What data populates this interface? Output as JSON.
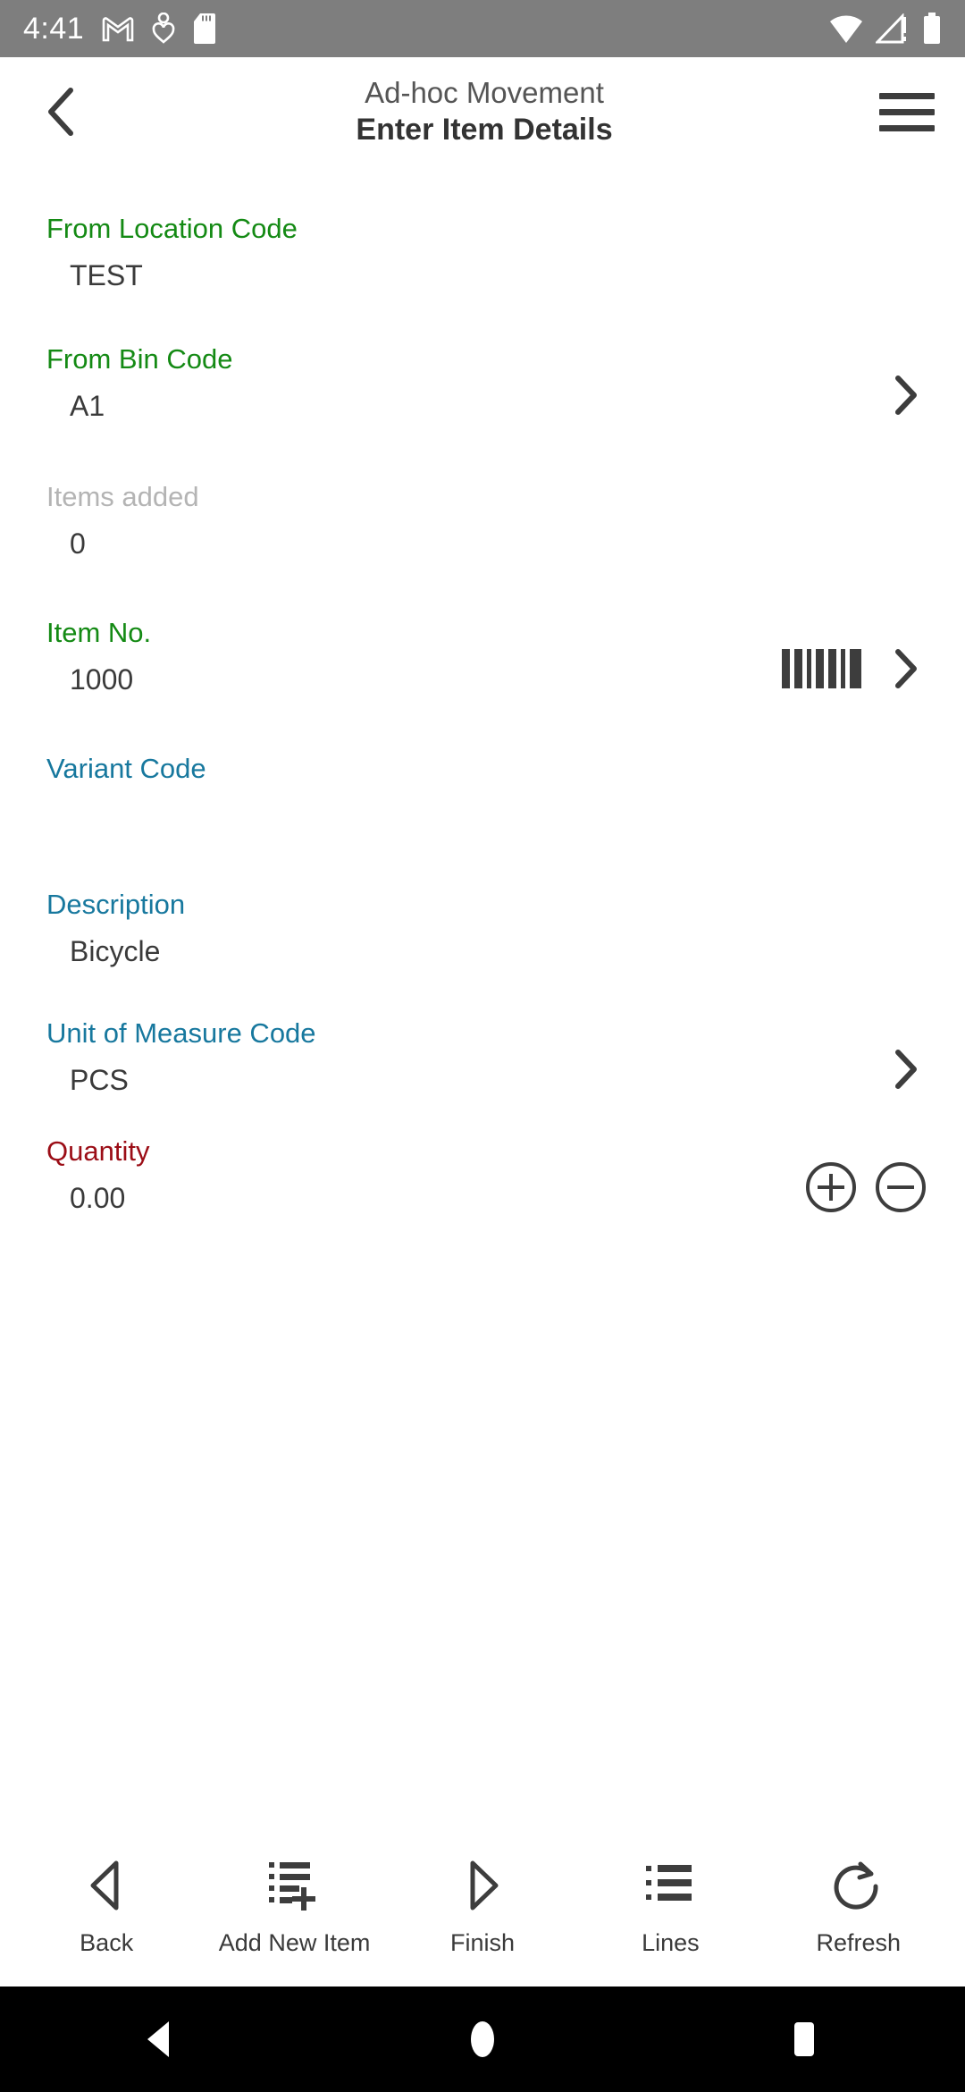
{
  "statusbar": {
    "time": "4:41",
    "left_icons": [
      "gmail-icon",
      "fitness-heart-icon",
      "sd-card-icon"
    ],
    "right_icons": [
      "wifi-icon",
      "cellular-no-signal-icon",
      "battery-icon"
    ]
  },
  "header": {
    "back": "back-chevron-icon",
    "subtitle": "Ad-hoc Movement",
    "title": "Enter Item Details",
    "menu": "hamburger-menu-icon"
  },
  "form": {
    "fields": [
      {
        "name": "from-location-code",
        "label": "From Location Code",
        "value": "TEST",
        "label_color": "#148a14",
        "style": "green",
        "actions": []
      },
      {
        "name": "from-bin-code",
        "label": "From Bin Code",
        "value": "A1",
        "label_color": "#148a14",
        "style": "green",
        "actions": [
          "chevron-right-icon"
        ]
      },
      {
        "name": "items-added",
        "label": "Items added",
        "value": "0",
        "label_color": "#b4b4b4",
        "style": "gray",
        "actions": []
      },
      {
        "name": "item-no",
        "label": "Item No.",
        "value": "1000",
        "label_color": "#148a14",
        "style": "green",
        "actions": [
          "barcode-scan-icon",
          "chevron-right-icon"
        ]
      },
      {
        "name": "variant-code",
        "label": "Variant Code",
        "value": "",
        "label_color": "#17789e",
        "style": "teal",
        "actions": []
      },
      {
        "name": "description",
        "label": "Description",
        "value": "Bicycle",
        "label_color": "#17789e",
        "style": "teal",
        "actions": []
      },
      {
        "name": "unit-of-measure-code",
        "label": "Unit of Measure Code",
        "value": "PCS",
        "label_color": "#17789e",
        "style": "teal",
        "actions": [
          "chevron-right-icon"
        ]
      },
      {
        "name": "quantity",
        "label": "Quantity",
        "value": "0.00",
        "label_color": "#9b0d16",
        "style": "red",
        "actions": [
          "plus-circle-icon",
          "minus-circle-icon"
        ]
      }
    ]
  },
  "toolbar": {
    "items": [
      {
        "name": "back",
        "label": "Back",
        "icon": "triangle-left-icon"
      },
      {
        "name": "add-new-item",
        "label": "Add New Item",
        "icon": "list-add-icon"
      },
      {
        "name": "finish",
        "label": "Finish",
        "icon": "triangle-right-icon"
      },
      {
        "name": "lines",
        "label": "Lines",
        "icon": "list-icon"
      },
      {
        "name": "refresh",
        "label": "Refresh",
        "icon": "refresh-icon"
      }
    ]
  },
  "navbar": {
    "items": [
      {
        "name": "android-back",
        "icon": "nav-back-triangle-icon"
      },
      {
        "name": "android-home",
        "icon": "nav-home-circle-icon"
      },
      {
        "name": "android-recents",
        "icon": "nav-recents-square-icon"
      }
    ]
  }
}
